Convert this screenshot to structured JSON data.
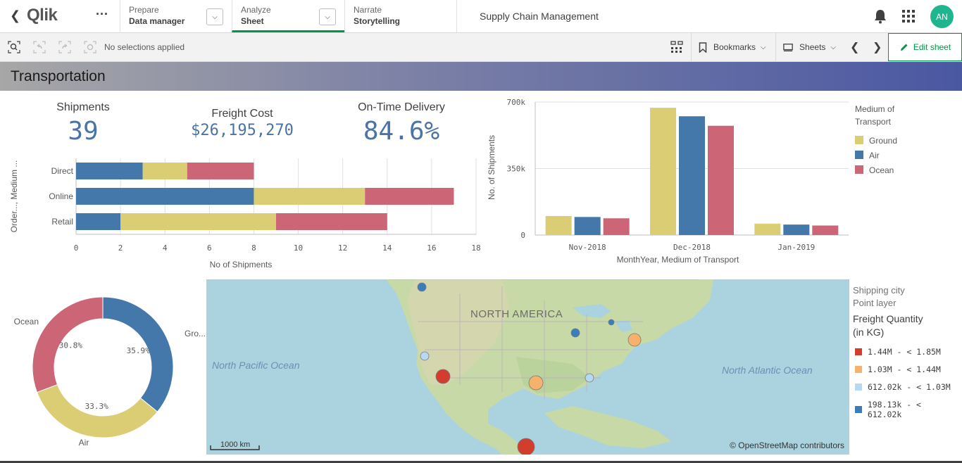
{
  "header": {
    "back_icon": "chevron-left-icon",
    "logo": "Qlik",
    "more_icon": "ellipsis-icon",
    "nav": [
      {
        "caption": "Prepare",
        "label": "Data manager"
      },
      {
        "caption": "Analyze",
        "label": "Sheet"
      },
      {
        "caption": "Narrate",
        "label": "Storytelling"
      }
    ],
    "app_title": "Supply Chain Management",
    "avatar_initials": "AN"
  },
  "toolbar": {
    "selections_text": "No selections applied",
    "bookmarks_label": "Bookmarks",
    "sheets_label": "Sheets",
    "edit_label": "Edit sheet"
  },
  "sheet": {
    "title": "Transportation"
  },
  "kpis": [
    {
      "title": "Shipments",
      "value": "39"
    },
    {
      "title": "Freight Cost",
      "value": "$26,195,270"
    },
    {
      "title": "On-Time Delivery",
      "value": "84.6%"
    }
  ],
  "colors": {
    "ground": "#dbcd73",
    "air": "#4477aa",
    "ocean": "#cc6677",
    "accent": "#009845"
  },
  "chart_data": [
    {
      "type": "bar",
      "orientation": "horizontal",
      "stacked": true,
      "categories": [
        "Direct",
        "Online",
        "Retail"
      ],
      "series": [
        {
          "name": "Air",
          "values": [
            3,
            8,
            2
          ]
        },
        {
          "name": "Ground",
          "values": [
            2,
            5,
            7
          ]
        },
        {
          "name": "Ocean",
          "values": [
            3,
            4,
            5
          ]
        }
      ],
      "xlabel": "No of Shipments",
      "ylabel": "Order..., Medium ...",
      "xlim": [
        0,
        18
      ],
      "xticks": [
        "0",
        "2",
        "4",
        "6",
        "8",
        "10",
        "12",
        "14",
        "16",
        "18"
      ],
      "grid": true
    },
    {
      "type": "bar",
      "orientation": "vertical",
      "categories": [
        "Nov-2018",
        "Dec-2018",
        "Jan-2019"
      ],
      "series": [
        {
          "name": "Ground",
          "values": [
            100000,
            670000,
            60000
          ]
        },
        {
          "name": "Air",
          "values": [
            95000,
            625000,
            55000
          ]
        },
        {
          "name": "Ocean",
          "values": [
            88000,
            575000,
            50000
          ]
        }
      ],
      "xlabel": "MonthYear, Medium of Transport",
      "ylabel": "No. of Shipments",
      "ylim": [
        0,
        700000
      ],
      "yticks": [
        "0",
        "350k",
        "700k"
      ],
      "legend_title": "Medium of Transport",
      "legend_items": [
        "Ground",
        "Air",
        "Ocean"
      ],
      "legend_position": "right",
      "grid": true
    },
    {
      "type": "pie",
      "donut": true,
      "slices": [
        {
          "name": "Gro...",
          "value": 35.9,
          "label": "35.9%"
        },
        {
          "name": "Air",
          "value": 33.3,
          "label": "33.3%"
        },
        {
          "name": "Ocean",
          "value": 30.8,
          "label": "30.8%"
        }
      ]
    }
  ],
  "map": {
    "labels": {
      "continent": "NORTH AMERICA",
      "pacific": "North Pacific Ocean",
      "atlantic": "North Atlantic Ocean"
    },
    "scale": "1000 km",
    "attribution": "© OpenStreetMap contributors",
    "legend": {
      "layer": "Shipping city",
      "layer_type": "Point layer",
      "title": "Freight Quantity (in KG)",
      "items": [
        {
          "label": "1.44M - < 1.85M",
          "color": "#d23d2d"
        },
        {
          "label": "1.03M - < 1.44M",
          "color": "#f6b26b"
        },
        {
          "label": "612.02k - < 1.03M",
          "color": "#b6d8f2"
        },
        {
          "label": "198.13k - < 612.02k",
          "color": "#3a7dbd"
        }
      ]
    }
  }
}
